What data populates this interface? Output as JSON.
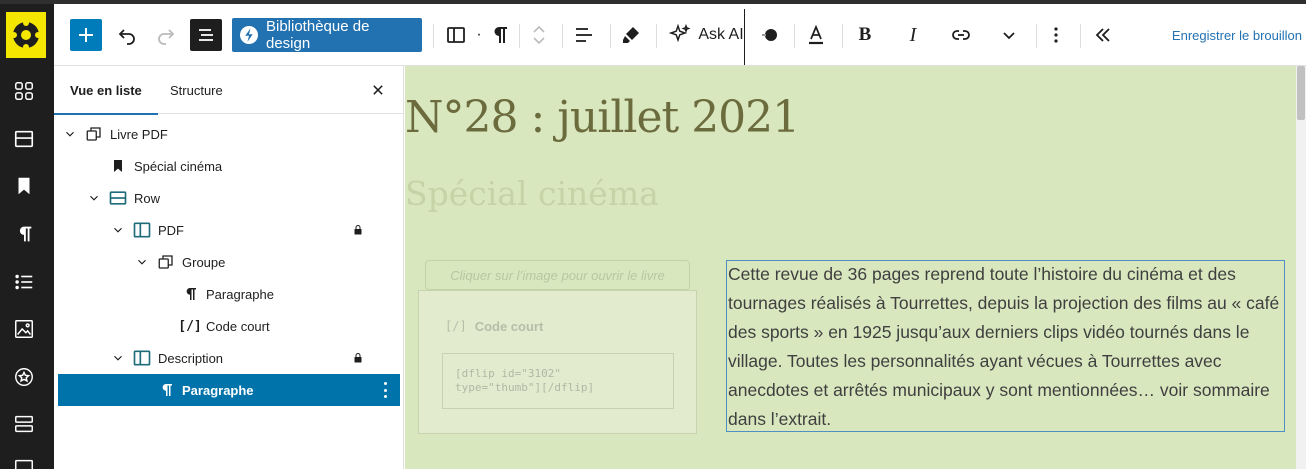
{
  "toolbar": {
    "library_label": "Bibliothèque de design",
    "ask_ai_label": "Ask AI",
    "save_draft_label": "Enregistrer le brouillon"
  },
  "panel": {
    "tabs": [
      {
        "label": "Vue en liste",
        "active": true
      },
      {
        "label": "Structure",
        "active": false
      }
    ],
    "tree": [
      {
        "label": "Livre PDF",
        "level": 0,
        "icon": "group-icon",
        "expanded": true
      },
      {
        "label": "Spécial cinéma",
        "level": 1,
        "icon": "bookmark-icon"
      },
      {
        "label": "Row",
        "level": 1,
        "icon": "row-icon",
        "expanded": true
      },
      {
        "label": "PDF",
        "level": 2,
        "icon": "column-icon",
        "expanded": true,
        "locked": true
      },
      {
        "label": "Groupe",
        "level": 3,
        "icon": "group-icon",
        "expanded": true
      },
      {
        "label": "Paragraphe",
        "level": 4,
        "icon": "paragraph-icon"
      },
      {
        "label": "Code court",
        "level": 4,
        "icon": "shortcode-icon"
      },
      {
        "label": "Description",
        "level": 2,
        "icon": "column-icon",
        "expanded": true,
        "locked": true
      },
      {
        "label": "Paragraphe",
        "level": 3,
        "icon": "paragraph-icon",
        "selected": true
      }
    ]
  },
  "canvas": {
    "title": "N°28 : juillet 2021",
    "subtitle": "Spécial cinéma",
    "click_note": "Cliquer sur l’image pour ouvrir le livre",
    "shortcode_label": "Code court",
    "shortcode_text": "[dflip id=\"3102\"\ntype=\"thumb\"][/dflip]",
    "description": "Cette revue de 36 pages reprend toute l’histoire du cinéma et des tournages réalisés à Tourrettes, depuis la projection des films au « café des sports » en 1925 jusqu’aux derniers clips vidéo tournés dans le village. Toutes les personnalités ayant vécues à Tourrettes avec anecdotes et arrêtés municipaux y sont mentionnées… voir sommaire dans l’extrait."
  },
  "colors": {
    "accent": "#007cba",
    "canvas_bg": "#d9e7bf",
    "sidebar_bg": "#1e1e1e",
    "logo_bg": "#f5e600"
  }
}
